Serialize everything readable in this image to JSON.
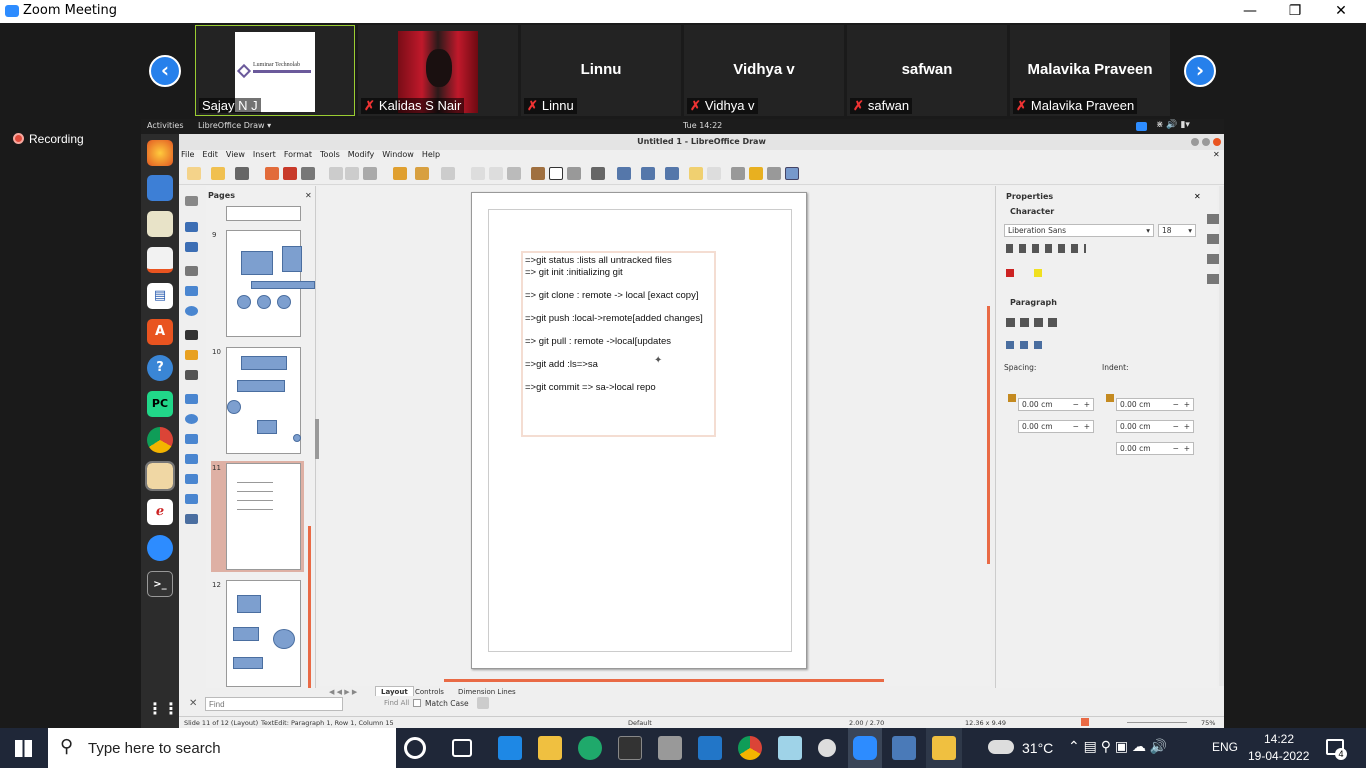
{
  "window": {
    "title": "Zoom Meeting"
  },
  "participants": [
    {
      "name": "Sajay N J",
      "logo_text": "Luminar Technolab",
      "muted": false
    },
    {
      "name": "Kalidas S Nair",
      "muted": true
    },
    {
      "name": "Linnu",
      "muted": true
    },
    {
      "name": "Vidhya v",
      "muted": true
    },
    {
      "name": "safwan",
      "muted": true
    },
    {
      "name": "Malavika Praveen",
      "muted": true
    }
  ],
  "recording": {
    "label": "Recording"
  },
  "ubuntu": {
    "activities": "Activities",
    "app": "LibreOffice Draw ▾",
    "clock": "Tue 14:22"
  },
  "lo": {
    "title": "Untitled 1 - LibreOffice Draw",
    "menu": [
      "File",
      "Edit",
      "View",
      "Insert",
      "Format",
      "Tools",
      "Modify",
      "Window",
      "Help"
    ],
    "pages_title": "Pages",
    "page_numbers": [
      "9",
      "10",
      "11",
      "12"
    ],
    "slide_text": [
      "=>git status :lists all untracked files",
      "=> git init :initializing git",
      "",
      "=> git clone : remote -> local [exact copy]",
      "",
      "=>git push :local->remote[added changes]",
      "",
      "=> git pull : remote ->local[updates",
      "",
      "=>git add :ls=>sa",
      "",
      "=>git commit => sa->local repo"
    ],
    "tabs": [
      "Layout",
      "Controls",
      "Dimension Lines"
    ],
    "find": {
      "placeholder": "Find",
      "find_all": "Find All",
      "match_case": "Match Case"
    },
    "status": {
      "slide": "Slide 11 of 12 (Layout)",
      "edit": "TextEdit: Paragraph 1, Row 1, Column 15",
      "layout": "Default",
      "pos": "2.00 / 2.70",
      "size": "12.36 x 9.49",
      "zoom": "75%"
    },
    "properties": {
      "title": "Properties",
      "character": "Character",
      "font": "Liberation Sans",
      "size": "18",
      "paragraph": "Paragraph",
      "spacing": "Spacing:",
      "indent": "Indent:",
      "spacing_values": [
        "0.00 cm",
        "0.00 cm"
      ],
      "indent_values": [
        "0.00 cm",
        "0.00 cm",
        "0.00 cm"
      ]
    }
  },
  "taskbar": {
    "search_placeholder": "Type here to search",
    "weather": "31°C",
    "lang": "ENG",
    "time": "14:22",
    "date": "19-04-2022",
    "notifications": "4"
  }
}
